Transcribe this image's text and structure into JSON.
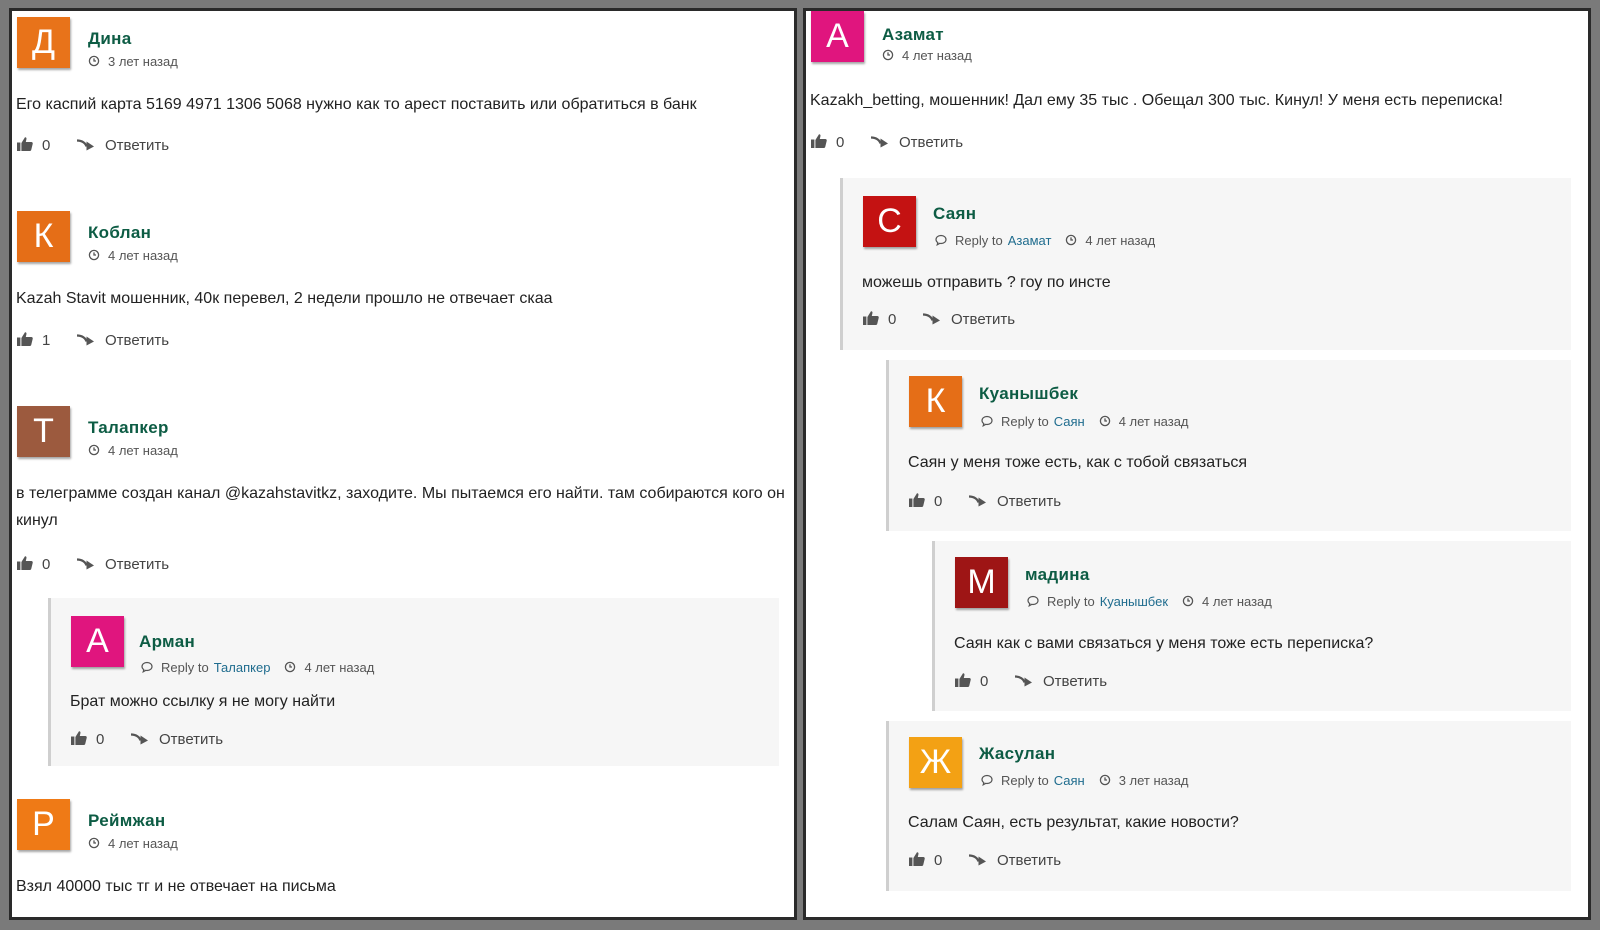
{
  "common": {
    "reply_label": "Ответить",
    "reply_to": "Reply to"
  },
  "left": [
    {
      "name": "Дина",
      "initial": "Д",
      "color": "#e8731a",
      "time": "3 лет назад",
      "text": "Его каспий карта 5169 4971 1306 5068 нужно как то арест поставить или обратиться в банк",
      "likes": "0"
    },
    {
      "name": "Коблан",
      "initial": "К",
      "color": "#e56e17",
      "time": "4 лет назад",
      "text": "Kazah Stavit мошенник, 40к перевел, 2 недели прошло не отвечает скаа",
      "likes": "1"
    },
    {
      "name": "Талапкер",
      "initial": "Т",
      "color": "#9c5a3e",
      "time": "4 лет назад",
      "text": "в телеграмме создан канал @kazahstavitkz, заходите. Мы пытаемся его найти. там собираются кого он кинул",
      "likes": "0"
    },
    {
      "name": "Арман",
      "initial": "А",
      "color": "#e0157e",
      "time": "4 лет назад",
      "reply_to_name": "Талапкер",
      "text": "Брат можно ссылку я не могу найти",
      "likes": "0"
    },
    {
      "name": "Реймжан",
      "initial": "Р",
      "color": "#ef7a16",
      "time": "4 лет назад",
      "text": "Взял 40000 тыс тг и не отвечает на письма"
    }
  ],
  "right": [
    {
      "name": "Азамат",
      "initial": "А",
      "color": "#e0157e",
      "time": "4 лет назад",
      "text": "Kazakh_betting, мошенник! Дал ему 35 тыс . Обещал 300 тыс. Кинул! У меня есть переписка!",
      "likes": "0"
    },
    {
      "name": "Саян",
      "initial": "С",
      "color": "#c41212",
      "time": "4 лет назад",
      "reply_to_name": "Азамат",
      "text": "можешь отправить ? гоу по инсте",
      "likes": "0"
    },
    {
      "name": "Куанышбек",
      "initial": "К",
      "color": "#e56e17",
      "time": "4 лет назад",
      "reply_to_name": "Саян",
      "text": "Саян у меня тоже есть, как с тобой связаться",
      "likes": "0"
    },
    {
      "name": "мадина",
      "initial": "М",
      "color": "#9e1515",
      "time": "4 лет назад",
      "reply_to_name": "Куанышбек",
      "text": "Саян как с вами связаться у меня тоже есть переписка?",
      "likes": "0"
    },
    {
      "name": "Жасулан",
      "initial": "Ж",
      "color": "#f3a114",
      "time": "3 лет назад",
      "reply_to_name": "Саян",
      "text": "Салам Саян, есть результат, какие новости?",
      "likes": "0"
    }
  ]
}
